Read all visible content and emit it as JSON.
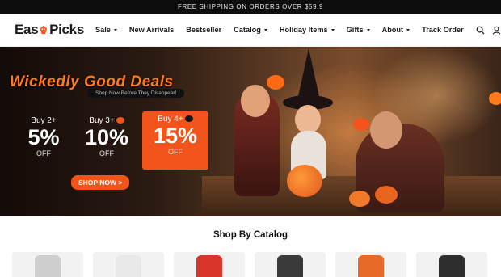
{
  "announcement": "FREE SHIPPING ON ORDERS OVER $59.9",
  "brand": {
    "logo_text_left": "Eas",
    "logo_text_right": "Picks"
  },
  "nav": {
    "items": [
      {
        "label": "Sale",
        "dropdown": true
      },
      {
        "label": "New Arrivals",
        "dropdown": false
      },
      {
        "label": "Bestseller",
        "dropdown": false
      },
      {
        "label": "Catalog",
        "dropdown": true
      },
      {
        "label": "Holiday Items",
        "dropdown": true
      },
      {
        "label": "Gifts",
        "dropdown": true
      },
      {
        "label": "About",
        "dropdown": true
      },
      {
        "label": "Track Order",
        "dropdown": false
      }
    ],
    "icons": [
      "search-icon",
      "account-icon",
      "cart-icon"
    ]
  },
  "hero": {
    "headline": "Wickedly Good Deals",
    "subheadline": "Shop Now Before They Disappear!",
    "deals": [
      {
        "buy": "Buy 2+",
        "percent": "5%",
        "off": "OFF"
      },
      {
        "buy": "Buy 3+",
        "percent": "10%",
        "off": "OFF"
      },
      {
        "buy": "Buy 4+",
        "percent": "15%",
        "off": "OFF"
      }
    ],
    "cta": "SHOP NOW >",
    "accent_color": "#f2541b",
    "headline_color": "#ff7a1a"
  },
  "catalog": {
    "title": "Shop By Catalog",
    "cards": [
      {
        "icon": "bottle-icon",
        "color": "#cfcfcf"
      },
      {
        "icon": "cookie-cutter-icon",
        "color": "#e8e8e8"
      },
      {
        "icon": "red-cable-icon",
        "color": "#d8352a"
      },
      {
        "icon": "tool-icon",
        "color": "#3a3a3a"
      },
      {
        "icon": "orange-tool-icon",
        "color": "#e86a2a"
      },
      {
        "icon": "dark-item-icon",
        "color": "#2e2e2e"
      }
    ]
  }
}
